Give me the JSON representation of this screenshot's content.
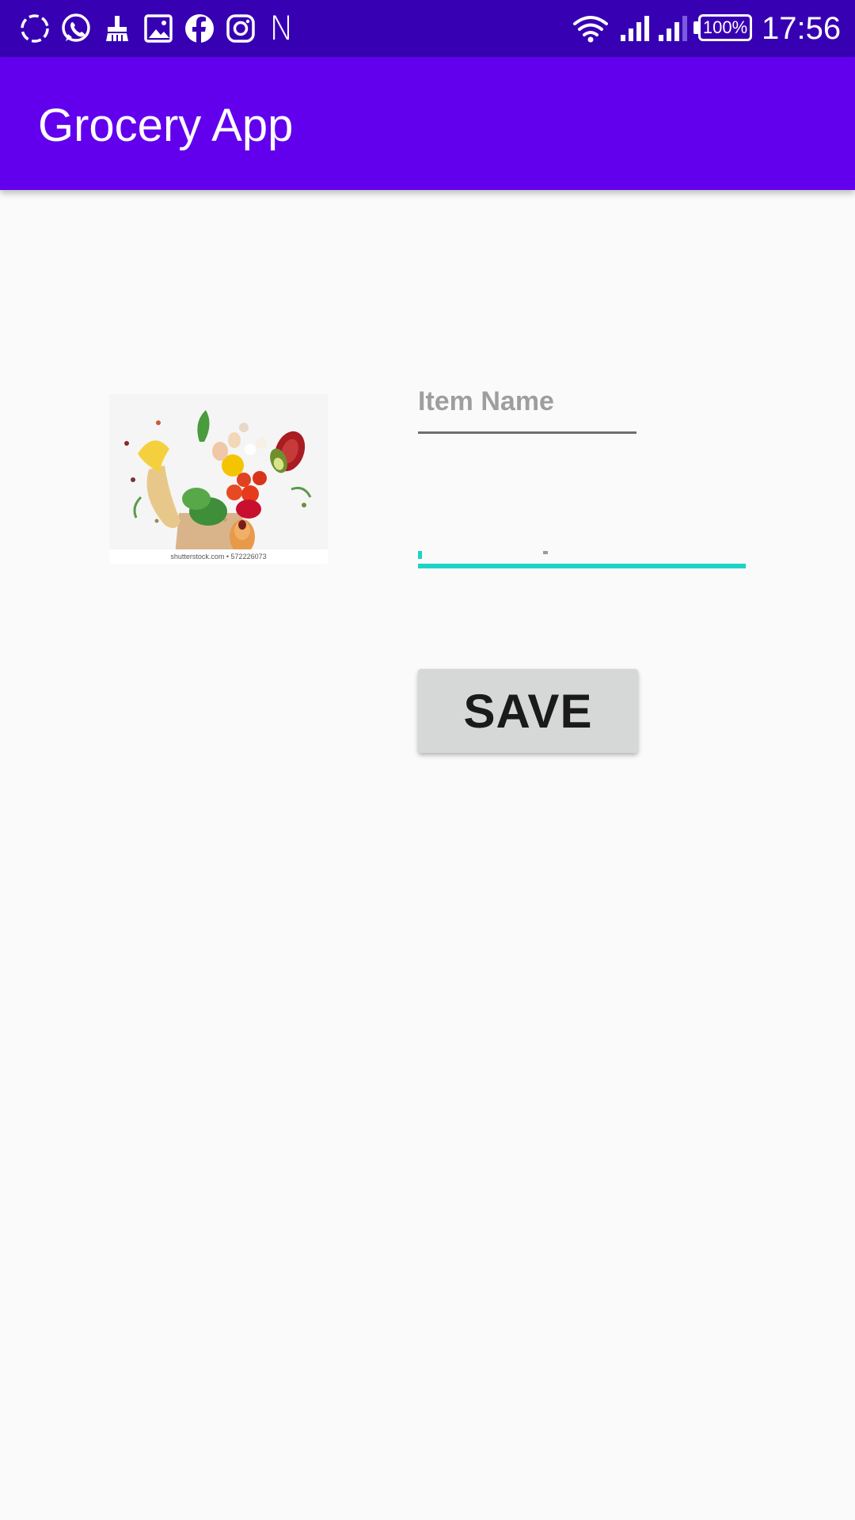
{
  "status_bar": {
    "time": "17:56",
    "battery": "100%",
    "notification_icons": [
      "sync-icon",
      "whatsapp-icon",
      "cleaner-icon",
      "gallery-icon",
      "facebook-icon",
      "instagram-icon",
      "n-icon"
    ],
    "n_letter": "N",
    "system_icons": [
      "wifi-icon",
      "signal-icon",
      "signal-icon",
      "battery-icon"
    ]
  },
  "app_bar": {
    "title": "Grocery App",
    "color": "#6200ee"
  },
  "form": {
    "image_caption": "shutterstock.com • 572226073",
    "item_name_placeholder": "Item Name",
    "item_name_value": "",
    "quantity_value": "",
    "accent_color": "#1dd3c6",
    "save_label": "SAVE"
  },
  "colors": {
    "status_bar": "#3700b3",
    "app_bar": "#6200ee",
    "background": "#fafafa",
    "button": "#d6d7d7"
  }
}
